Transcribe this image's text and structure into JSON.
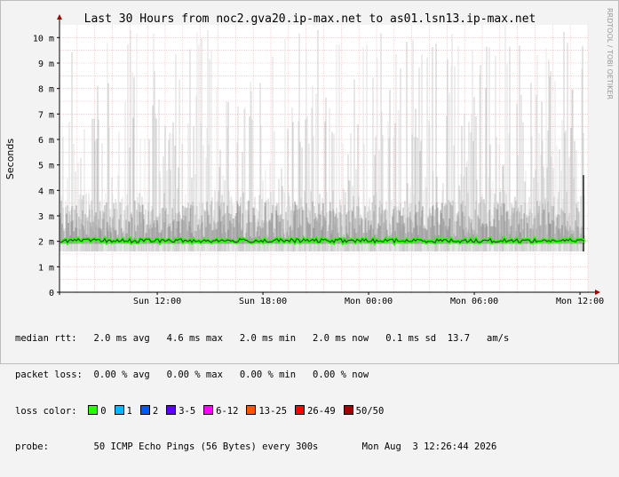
{
  "chart_data": {
    "type": "area",
    "title": "Last 30 Hours from noc2.gva20.ip-max.net to as01.lsn13.ip-max.net",
    "ylabel": "Seconds",
    "ylim": [
      0,
      0.0105
    ],
    "y_ticks": [
      {
        "value": 0,
        "label": "0"
      },
      {
        "value": 0.001,
        "label": "1 m"
      },
      {
        "value": 0.002,
        "label": "2 m"
      },
      {
        "value": 0.003,
        "label": "3 m"
      },
      {
        "value": 0.004,
        "label": "4 m"
      },
      {
        "value": 0.005,
        "label": "5 m"
      },
      {
        "value": 0.006,
        "label": "6 m"
      },
      {
        "value": 0.007,
        "label": "7 m"
      },
      {
        "value": 0.008,
        "label": "8 m"
      },
      {
        "value": 0.009,
        "label": "9 m"
      },
      {
        "value": 0.01,
        "label": "10 m"
      }
    ],
    "xlim_hours": [
      -30,
      0
    ],
    "x_ticks": [
      {
        "hour": -24.45,
        "label": "Sun 12:00"
      },
      {
        "hour": -18.45,
        "label": "Sun 18:00"
      },
      {
        "hour": -12.45,
        "label": "Mon 00:00"
      },
      {
        "hour": -6.45,
        "label": "Mon 06:00"
      },
      {
        "hour": -0.45,
        "label": "Mon 12:00"
      }
    ],
    "median_rtt_ms": 2.0,
    "median_rtt_range_ms": [
      1.95,
      2.1
    ],
    "smoke_max_ms": 10.5,
    "smoke_typical_top_ms": 4.6,
    "final_spike_ms": 4.6,
    "colors": {
      "background": "#f3f3f3",
      "plot": "#ffffff",
      "grid": "#e8b8b8",
      "median": "#2a2a2a",
      "loss_0": "#26ff00",
      "axis": "#000000"
    },
    "legend_placement": "below"
  },
  "vertical_label": "RRDTOOL / TOBI OETIKER",
  "stats": {
    "median_rtt": "median rtt:   2.0 ms avg   4.6 ms max   2.0 ms min   2.0 ms now   0.1 ms sd  13.7   am/s",
    "packet_loss": "packet loss:  0.00 % avg   0.00 % max   0.00 % min   0.00 % now",
    "loss_color_label": "loss color:",
    "loss_legend": [
      {
        "label": "0",
        "color": "#26ff00"
      },
      {
        "label": "1",
        "color": "#00b8ff"
      },
      {
        "label": "2",
        "color": "#0059ff"
      },
      {
        "label": "3-5",
        "color": "#5e00ff"
      },
      {
        "label": "6-12",
        "color": "#ff00ff"
      },
      {
        "label": "13-25",
        "color": "#ff5500"
      },
      {
        "label": "26-49",
        "color": "#ff0000"
      },
      {
        "label": "50/50",
        "color": "#a10000"
      }
    ],
    "probe": "probe:        50 ICMP Echo Pings (56 Bytes) every 300s",
    "date": "Mon Aug  3 12:26:44 2026"
  }
}
